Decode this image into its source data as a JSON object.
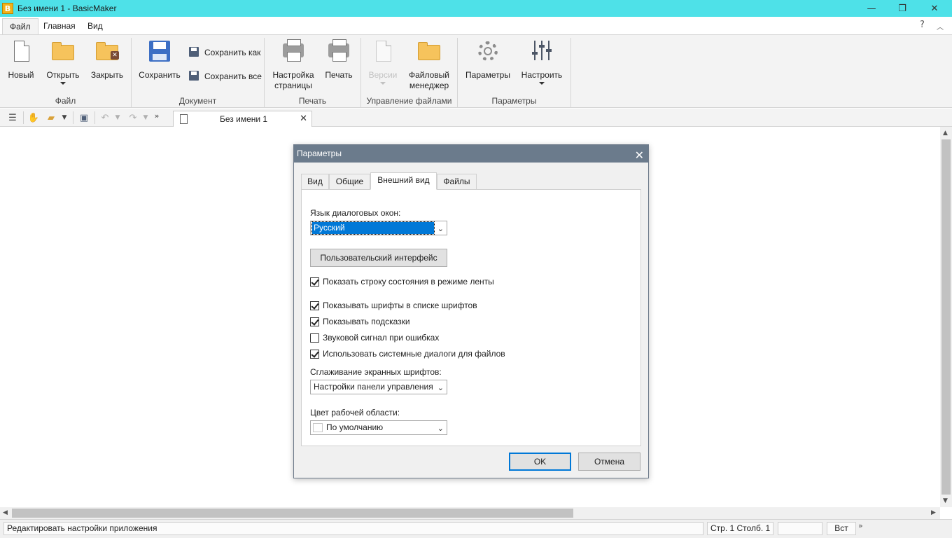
{
  "window": {
    "title": "Без имени 1 - BasicMaker",
    "app_icon_letter": "B"
  },
  "menu": {
    "tabs": [
      {
        "label": "Файл",
        "active": true
      },
      {
        "label": "Главная",
        "active": false
      },
      {
        "label": "Вид",
        "active": false
      }
    ],
    "help_icon": "?"
  },
  "ribbon": {
    "groups": {
      "file": {
        "label": "Файл",
        "new": "Новый",
        "open": "Открыть",
        "close": "Закрыть"
      },
      "document": {
        "label": "Документ",
        "save": "Сохранить",
        "save_as": "Сохранить как",
        "save_all": "Сохранить все"
      },
      "print": {
        "label": "Печать",
        "page_setup_line1": "Настройка",
        "page_setup_line2": "страницы",
        "print": "Печать"
      },
      "file_management": {
        "label": "Управление файлами",
        "versions": "Версии",
        "file_manager_line1": "Файловый",
        "file_manager_line2": "менеджер"
      },
      "settings": {
        "label": "Параметры",
        "options": "Параметры",
        "customize": "Настроить"
      }
    }
  },
  "document_tab": {
    "name": "Без имени 1"
  },
  "dialog": {
    "title": "Параметры",
    "tabs": [
      {
        "label": "Вид",
        "active": false
      },
      {
        "label": "Общие",
        "active": false
      },
      {
        "label": "Внешний вид",
        "active": true
      },
      {
        "label": "Файлы",
        "active": false
      }
    ],
    "language_label": "Язык диалоговых окон:",
    "language_value": "Русский",
    "ui_button": "Пользовательский интерфейс",
    "checkboxes": [
      {
        "label": "Показать строку состояния в режиме ленты",
        "checked": true
      },
      {
        "label": "Показывать шрифты в списке шрифтов",
        "checked": true
      },
      {
        "label": "Показывать подсказки",
        "checked": true
      },
      {
        "label": "Звуковой сигнал при ошибках",
        "checked": false
      },
      {
        "label": "Использовать системные диалоги для файлов",
        "checked": true
      }
    ],
    "smoothing_label": "Сглаживание экранных шрифтов:",
    "smoothing_value": "Настройки панели управления",
    "workspace_color_label": "Цвет рабочей области:",
    "workspace_color_value": "По умолчанию",
    "ok": "OK",
    "cancel": "Отмена"
  },
  "statusbar": {
    "message": "Редактировать настройки приложения",
    "position": "Стр. 1 Столб. 1",
    "empty_field": "",
    "insert_mode": "Вст"
  },
  "colors": {
    "titlebar": "#4ee1e8",
    "dialog_title": "#6b7b8c",
    "accent": "#0078d7",
    "save_icon": "#3d6fc4",
    "folder_icon": "#f6c35c"
  }
}
